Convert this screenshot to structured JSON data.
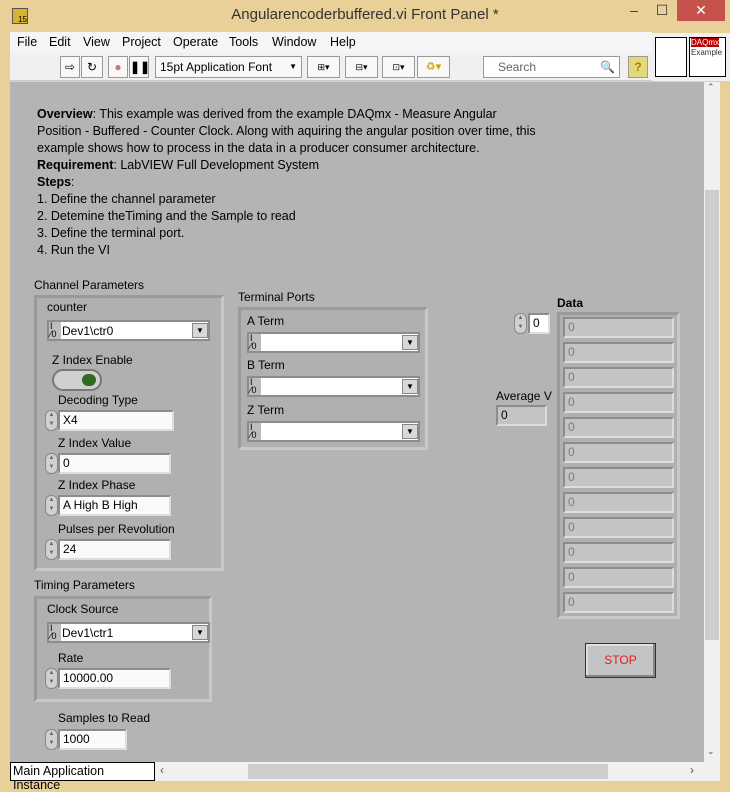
{
  "window": {
    "title": "Angularencoderbuffered.vi Front Panel *",
    "minimize": "–",
    "maximize": "☐",
    "close": "✕"
  },
  "menu": [
    "File",
    "Edit",
    "View",
    "Project",
    "Operate",
    "Tools",
    "Window",
    "Help"
  ],
  "toolbar": {
    "font": "15pt Application Font",
    "search_placeholder": "Search",
    "help": "?"
  },
  "icon_pane": {
    "label": "DAQmx Example"
  },
  "description": {
    "overview_label": "Overview",
    "overview": ": This example was derived from the example DAQmx - Measure Angular Position - Buffered - Counter Clock. Along with aquiring the angular position over time, this example shows how to process in the data in a producer consumer architecture.",
    "requirement_label": "Requirement",
    "requirement": ": LabVIEW Full Development System",
    "steps_label": "Steps",
    "steps_colon": ":",
    "steps": [
      "1. Define the channel parameter",
      "2. Detemine theTiming and the Sample to read",
      "3. Define the terminal port.",
      "4. Run the VI"
    ]
  },
  "channel": {
    "title": "Channel Parameters",
    "counter_label": "counter",
    "counter": "Dev1\\ctr0",
    "z_enable_label": "Z Index Enable",
    "z_enable": false,
    "decoding_label": "Decoding Type",
    "decoding": "X4",
    "z_value_label": "Z Index Value",
    "z_value": "0",
    "z_phase_label": "Z Index Phase",
    "z_phase": "A High B High",
    "ppr_label": "Pulses per Revolution",
    "ppr": "24"
  },
  "terminal": {
    "title": "Terminal Ports",
    "a_label": "A Term",
    "a": "",
    "b_label": "B Term",
    "b": "",
    "z_label": "Z Term",
    "z": ""
  },
  "timing": {
    "title": "Timing Parameters",
    "clock_label": "Clock Source",
    "clock": "Dev1\\ctr1",
    "rate_label": "Rate",
    "rate": "10000.00"
  },
  "samples": {
    "label": "Samples to Read",
    "value": "1000"
  },
  "data": {
    "label": "Data",
    "index": "0",
    "values": [
      "0",
      "0",
      "0",
      "0",
      "0",
      "0",
      "0",
      "0",
      "0",
      "0",
      "0",
      "0"
    ]
  },
  "average": {
    "label": "Average V",
    "value": "0"
  },
  "stop": {
    "label": "STOP",
    "color": "#e02020"
  },
  "status": {
    "instance": "Main Application Instance"
  }
}
